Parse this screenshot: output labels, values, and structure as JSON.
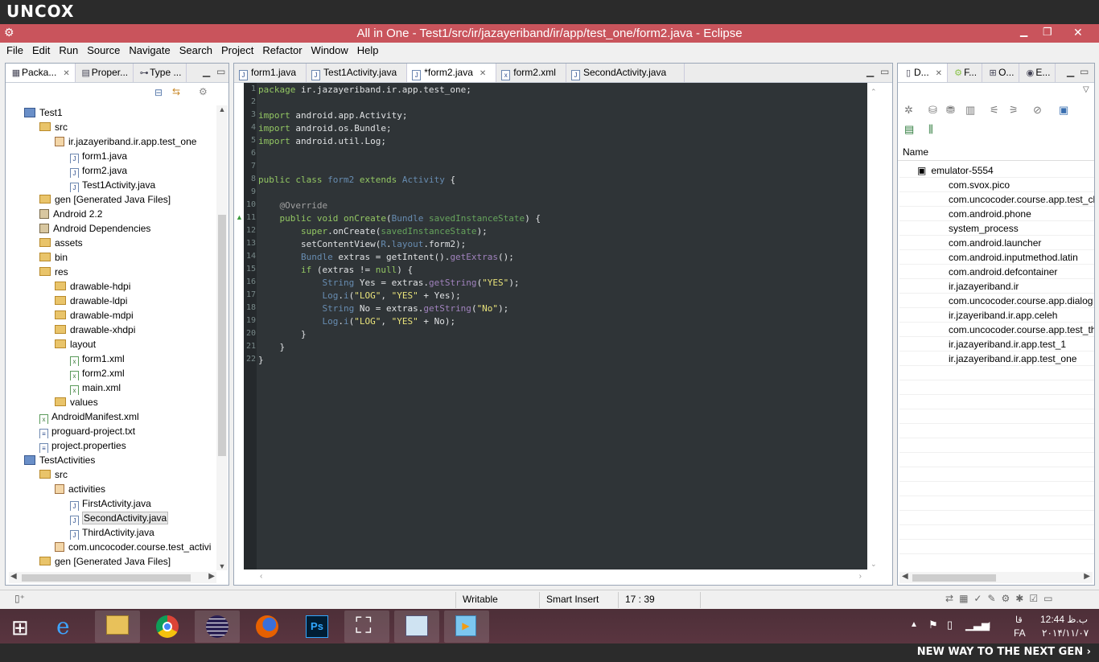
{
  "brand": "UNCOX",
  "window": {
    "title": "All in One - Test1/src/ir/jazayeriband/ir/app/test_one/form2.java - Eclipse",
    "minimize": "▁",
    "maximize": "❐",
    "close": "✕"
  },
  "menu": [
    "File",
    "Edit",
    "Run",
    "Source",
    "Navigate",
    "Search",
    "Project",
    "Refactor",
    "Window",
    "Help"
  ],
  "left_panel": {
    "tabs": [
      "Packa...",
      "Proper...",
      "Type ..."
    ],
    "tree": [
      {
        "label": "Test1",
        "depth": 1,
        "kind": "project"
      },
      {
        "label": "src",
        "depth": 2,
        "kind": "folder"
      },
      {
        "label": "ir.jazayeriband.ir.app.test_one",
        "depth": 3,
        "kind": "package"
      },
      {
        "label": "form1.java",
        "depth": 4,
        "kind": "java"
      },
      {
        "label": "form2.java",
        "depth": 4,
        "kind": "java"
      },
      {
        "label": "Test1Activity.java",
        "depth": 4,
        "kind": "java"
      },
      {
        "label": "gen [Generated Java Files]",
        "depth": 2,
        "kind": "folder"
      },
      {
        "label": "Android 2.2",
        "depth": 2,
        "kind": "lib"
      },
      {
        "label": "Android Dependencies",
        "depth": 2,
        "kind": "lib"
      },
      {
        "label": "assets",
        "depth": 2,
        "kind": "folder"
      },
      {
        "label": "bin",
        "depth": 2,
        "kind": "folder"
      },
      {
        "label": "res",
        "depth": 2,
        "kind": "folder"
      },
      {
        "label": "drawable-hdpi",
        "depth": 3,
        "kind": "folder"
      },
      {
        "label": "drawable-ldpi",
        "depth": 3,
        "kind": "folder"
      },
      {
        "label": "drawable-mdpi",
        "depth": 3,
        "kind": "folder"
      },
      {
        "label": "drawable-xhdpi",
        "depth": 3,
        "kind": "folder"
      },
      {
        "label": "layout",
        "depth": 3,
        "kind": "folder"
      },
      {
        "label": "form1.xml",
        "depth": 4,
        "kind": "xml"
      },
      {
        "label": "form2.xml",
        "depth": 4,
        "kind": "xml"
      },
      {
        "label": "main.xml",
        "depth": 4,
        "kind": "xml"
      },
      {
        "label": "values",
        "depth": 3,
        "kind": "folder"
      },
      {
        "label": "AndroidManifest.xml",
        "depth": 2,
        "kind": "xml"
      },
      {
        "label": "proguard-project.txt",
        "depth": 2,
        "kind": "file"
      },
      {
        "label": "project.properties",
        "depth": 2,
        "kind": "file"
      },
      {
        "label": "TestActivities",
        "depth": 1,
        "kind": "project"
      },
      {
        "label": "src",
        "depth": 2,
        "kind": "folder"
      },
      {
        "label": "activities",
        "depth": 3,
        "kind": "package"
      },
      {
        "label": "FirstActivity.java",
        "depth": 4,
        "kind": "java"
      },
      {
        "label": "SecondActivity.java",
        "depth": 4,
        "kind": "java",
        "selected": true
      },
      {
        "label": "ThirdActivity.java",
        "depth": 4,
        "kind": "java"
      },
      {
        "label": "com.uncocoder.course.test_activi",
        "depth": 3,
        "kind": "package"
      },
      {
        "label": "gen [Generated Java Files]",
        "depth": 2,
        "kind": "folder"
      }
    ]
  },
  "editor": {
    "tabs": [
      {
        "label": "form1.java",
        "active": false
      },
      {
        "label": "Test1Activity.java",
        "active": false
      },
      {
        "label": "*form2.java",
        "active": true
      },
      {
        "label": "form2.xml",
        "active": false
      },
      {
        "label": "SecondActivity.java",
        "active": false
      }
    ],
    "line_numbers": [
      "1",
      "2",
      "3",
      "4",
      "5",
      "6",
      "7",
      "8",
      "9",
      "10",
      "11",
      "12",
      "13",
      "14",
      "15",
      "16",
      "17",
      "18",
      "19",
      "20",
      "21",
      "22"
    ]
  },
  "right_panel": {
    "tabs": [
      "D...",
      "F...",
      "O...",
      "E..."
    ],
    "column_header": "Name",
    "device": "emulator-5554",
    "processes": [
      "com.svox.pico",
      "com.uncocoder.course.app.test_cl",
      "com.android.phone",
      "system_process",
      "com.android.launcher",
      "com.android.inputmethod.latin",
      "com.android.defcontainer",
      "ir.jazayeriband.ir",
      "com.uncocoder.course.app.dialog",
      "ir.jzayeriband.ir.app.celeh",
      "com.uncocoder.course.app.test_th",
      "ir.jazayeriband.ir.app.test_1",
      "ir.jazayeriband.ir.app.test_one"
    ]
  },
  "status": {
    "mode": "Writable",
    "insert": "Smart Insert",
    "position": "17 : 39"
  },
  "taskbar": {
    "apps": [
      "start",
      "ie",
      "explorer",
      "chrome",
      "eclipse",
      "firefox",
      "photoshop",
      "app",
      "notepad",
      "media"
    ],
    "lang": "FA",
    "time": "12:44 ب.ظ",
    "date": "۲۰۱۴/۱۱/۰۷",
    "tray_text": "قا"
  },
  "footer": "NEW WAY TO THE NEXT GEN ›"
}
